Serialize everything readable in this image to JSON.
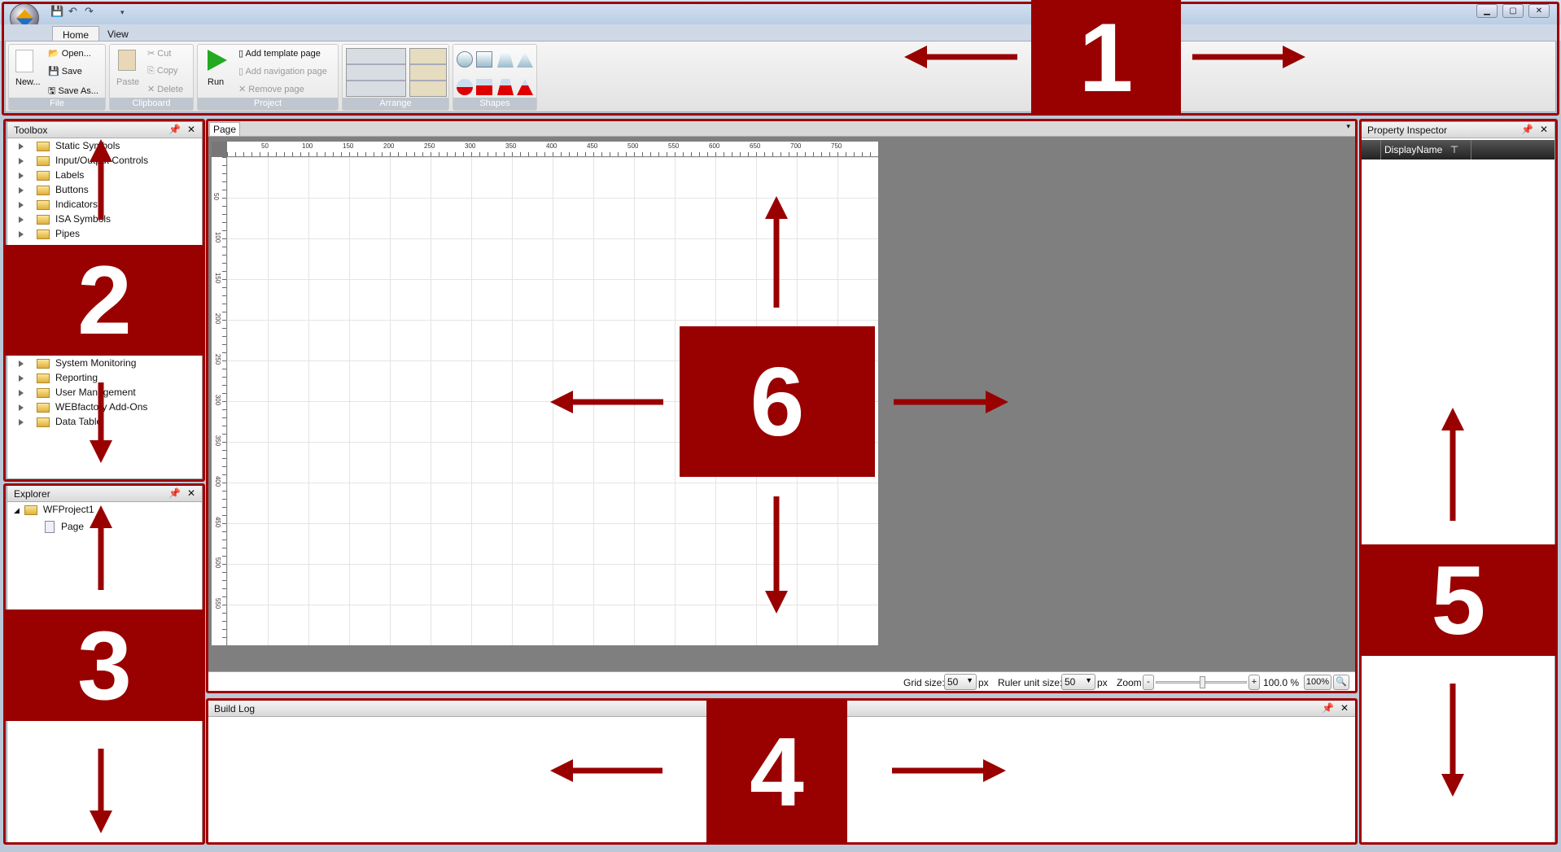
{
  "quick_access": {
    "icons": [
      "save-icon",
      "undo-icon",
      "redo-icon",
      "customize-dropdown-icon"
    ]
  },
  "tabs": [
    {
      "label": "Home"
    },
    {
      "label": "View"
    }
  ],
  "ribbon": {
    "file": {
      "label": "File",
      "new": "New...",
      "open": "Open...",
      "save": "Save",
      "save_as": "Save As..."
    },
    "clipboard": {
      "label": "Clipboard",
      "paste": "Paste",
      "cut": "Cut",
      "copy": "Copy",
      "delete": "Delete"
    },
    "project": {
      "label": "Project",
      "run": "Run",
      "add_template": "Add template page",
      "add_navigation": "Add navigation page",
      "remove": "Remove page"
    },
    "arrange": {
      "label": "Arrange"
    },
    "shapes": {
      "label": "Shapes"
    }
  },
  "toolbox": {
    "title": "Toolbox",
    "items": [
      "Static Symbols",
      "Input/Output Controls",
      "Labels",
      "Buttons",
      "Indicators",
      "ISA Symbols",
      "Pipes",
      "System Monitoring",
      "Reporting",
      "User Management",
      "WEBfactory Add-Ons",
      "Data Table"
    ]
  },
  "explorer": {
    "title": "Explorer",
    "project": "WFProject1",
    "page": "Page"
  },
  "document": {
    "tab": "Page",
    "ruler_x": [
      "50",
      "100",
      "150",
      "200",
      "250",
      "300",
      "350",
      "400",
      "450",
      "500",
      "550",
      "600",
      "650",
      "700",
      "750"
    ],
    "ruler_y": [
      "50",
      "100",
      "150",
      "200",
      "250",
      "300",
      "350",
      "400",
      "450",
      "500",
      "550"
    ]
  },
  "statusbar": {
    "grid_label": "Grid size:",
    "grid_value": "50",
    "px1": "px",
    "ruler_label": "Ruler unit size:",
    "ruler_value": "50",
    "px2": "px",
    "zoom_label": "Zoom",
    "minus": "-",
    "plus": "+",
    "zoom_value": "100.0 %",
    "reset": "100%",
    "zoom_percent": 100
  },
  "build_log": {
    "title": "Build Log"
  },
  "property_inspector": {
    "title": "Property Inspector",
    "column": "DisplayName"
  },
  "callouts": [
    "1",
    "2",
    "3",
    "4",
    "5",
    "6"
  ],
  "colors": {
    "callout": "#990000"
  }
}
